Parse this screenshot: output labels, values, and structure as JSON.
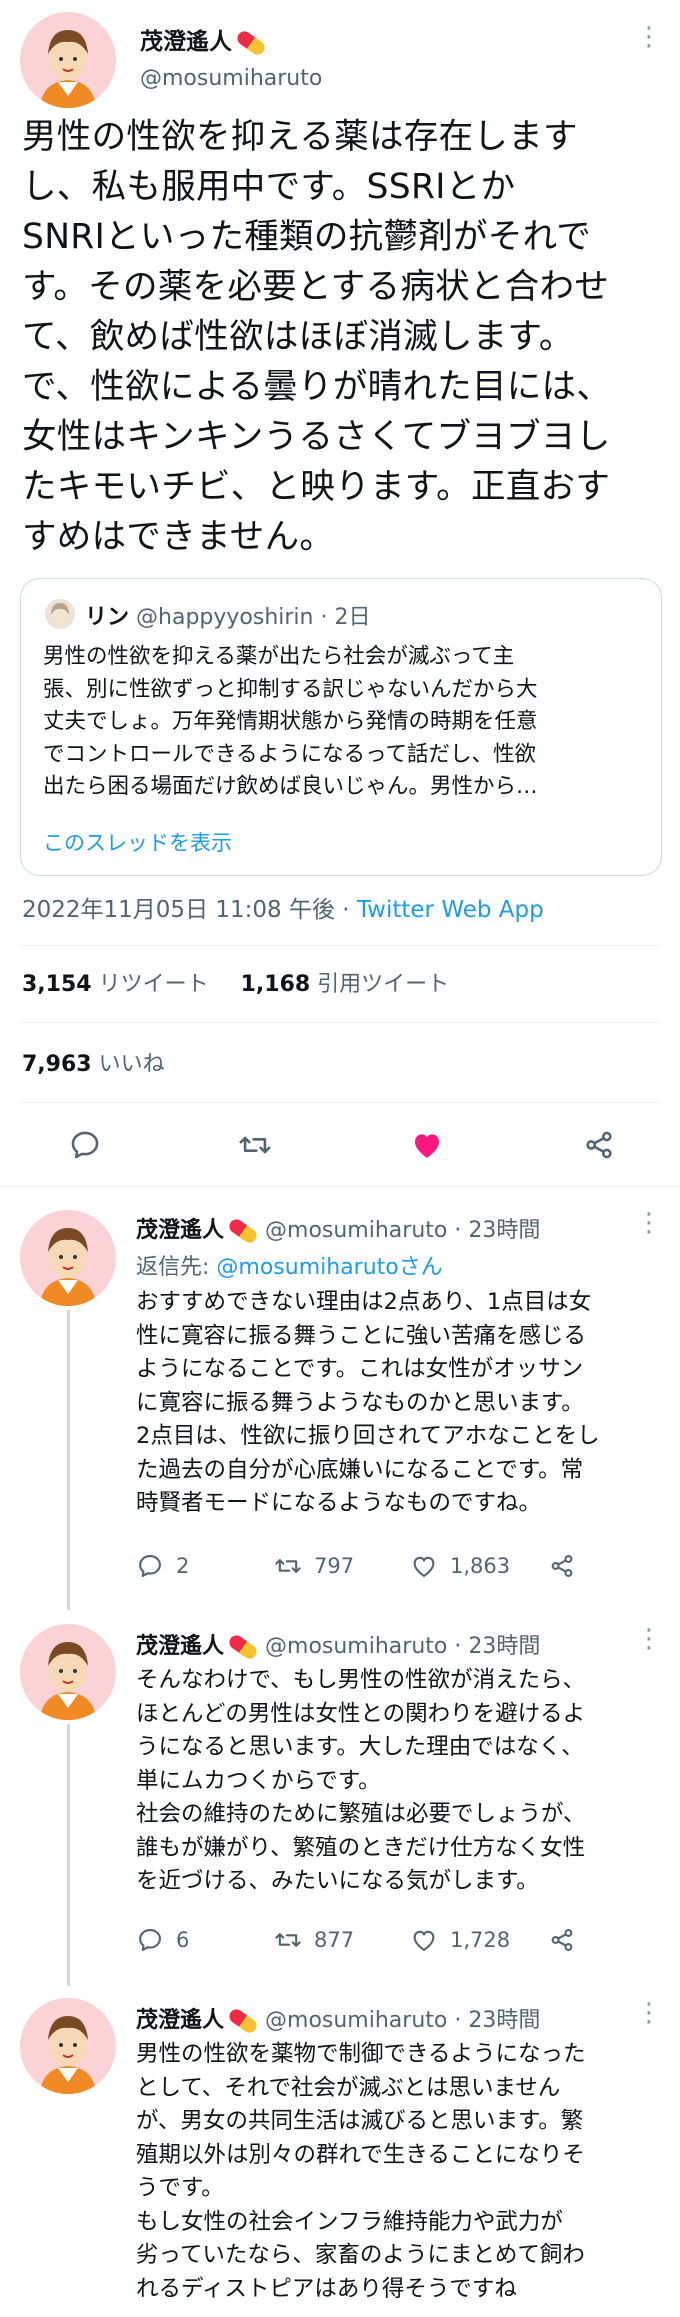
{
  "main_tweet": {
    "author_name": "茂澄遙人",
    "author_handle": "@mosumiharuto",
    "lines": [
      "男性の性欲を抑える薬は存在します",
      "し、私も服用中です。SSRIとか",
      "SNRIといった種類の抗鬱剤がそれで",
      "す。その薬を必要とする病状と合わせ",
      "て、飲めば性欲はほぼ消滅します。",
      "で、性欲による曇りが晴れた目には、",
      "女性はキンキンうるさくてブヨブヨし",
      "たキモいチビ、と映ります。正直おす",
      "すめはできません。"
    ],
    "timestamp": "2022年11月05日 11:08 午後",
    "separator": " · ",
    "source": "Twitter Web App",
    "retweets_count": "3,154",
    "retweets_label": " リツイート",
    "quotes_count": "1,168",
    "quotes_label": " 引用ツイート",
    "likes_count": "7,963",
    "likes_label": " いいね"
  },
  "quoted_tweet": {
    "author_name": "リン",
    "author_handle": "@happyyoshirin",
    "time": " · 2日",
    "lines": [
      "男性の性欲を抑える薬が出たら社会が滅ぶって主",
      "張、別に性欲ずっと抑制する訳じゃないんだから大",
      "丈夫でしょ。万年発情期状態から発情の時期を任意",
      "でコントロールできるようになるって話だし、性欲",
      "出たら困る場面だけ飲めば良いじゃん。男性から…"
    ],
    "show_thread": "このスレッドを表示"
  },
  "replies": [
    {
      "author_name": "茂澄遙人",
      "author_handle": "@mosumiharuto",
      "time": " · 23時間",
      "reply_to_prefix": "返信先: ",
      "reply_to": "@mosumiharutoさん",
      "text": "おすすめできない理由は2点あり、1点目は女\n性に寛容に振る舞うことに強い苦痛を感じる\nようになることです。これは女性がオッサン\nに寛容に振る舞うようなものかと思います。\n2点目は、性欲に振り回されてアホなことをし\nた過去の自分が心底嫌いになることです。常\n時賢者モードになるようなものですね。",
      "reply_count": "2",
      "retweet_count": "797",
      "like_count": "1,863"
    },
    {
      "author_name": "茂澄遙人",
      "author_handle": "@mosumiharuto",
      "time": " · 23時間",
      "text": "そんなわけで、もし男性の性欲が消えたら、\nほとんどの男性は女性との関わりを避けるよ\nうになると思います。大した理由ではなく、\n単にムカつくからです。\n社会の維持のために繁殖は必要でしょうが、\n誰もが嫌がり、繁殖のときだけ仕方なく女性\nを近づける、みたいになる気がします。",
      "reply_count": "6",
      "retweet_count": "877",
      "like_count": "1,728"
    },
    {
      "author_name": "茂澄遙人",
      "author_handle": "@mosumiharuto",
      "time": " · 23時間",
      "text": "男性の性欲を薬物で制御できるようになった\nとして、それで社会が滅ぶとは思いません\nが、男女の共同生活は滅びると思います。繁\n殖期以外は別々の群れで生きることになりそ\nうです。\nもし女性の社会インフラ維持能力や武力が\n劣っていたなら、家畜のようにまとめて飼わ\nれるディストピアはあり得そうですね"
    }
  ],
  "icons": [
    "more-icon",
    "reply-icon",
    "retweet-icon",
    "like-icon",
    "share-icon",
    "pill-emoji-icon"
  ],
  "colors": {
    "accent": "#1d9bf0",
    "like": "#f91880",
    "secondary_text": "#536471",
    "divider": "#eff3f4"
  }
}
